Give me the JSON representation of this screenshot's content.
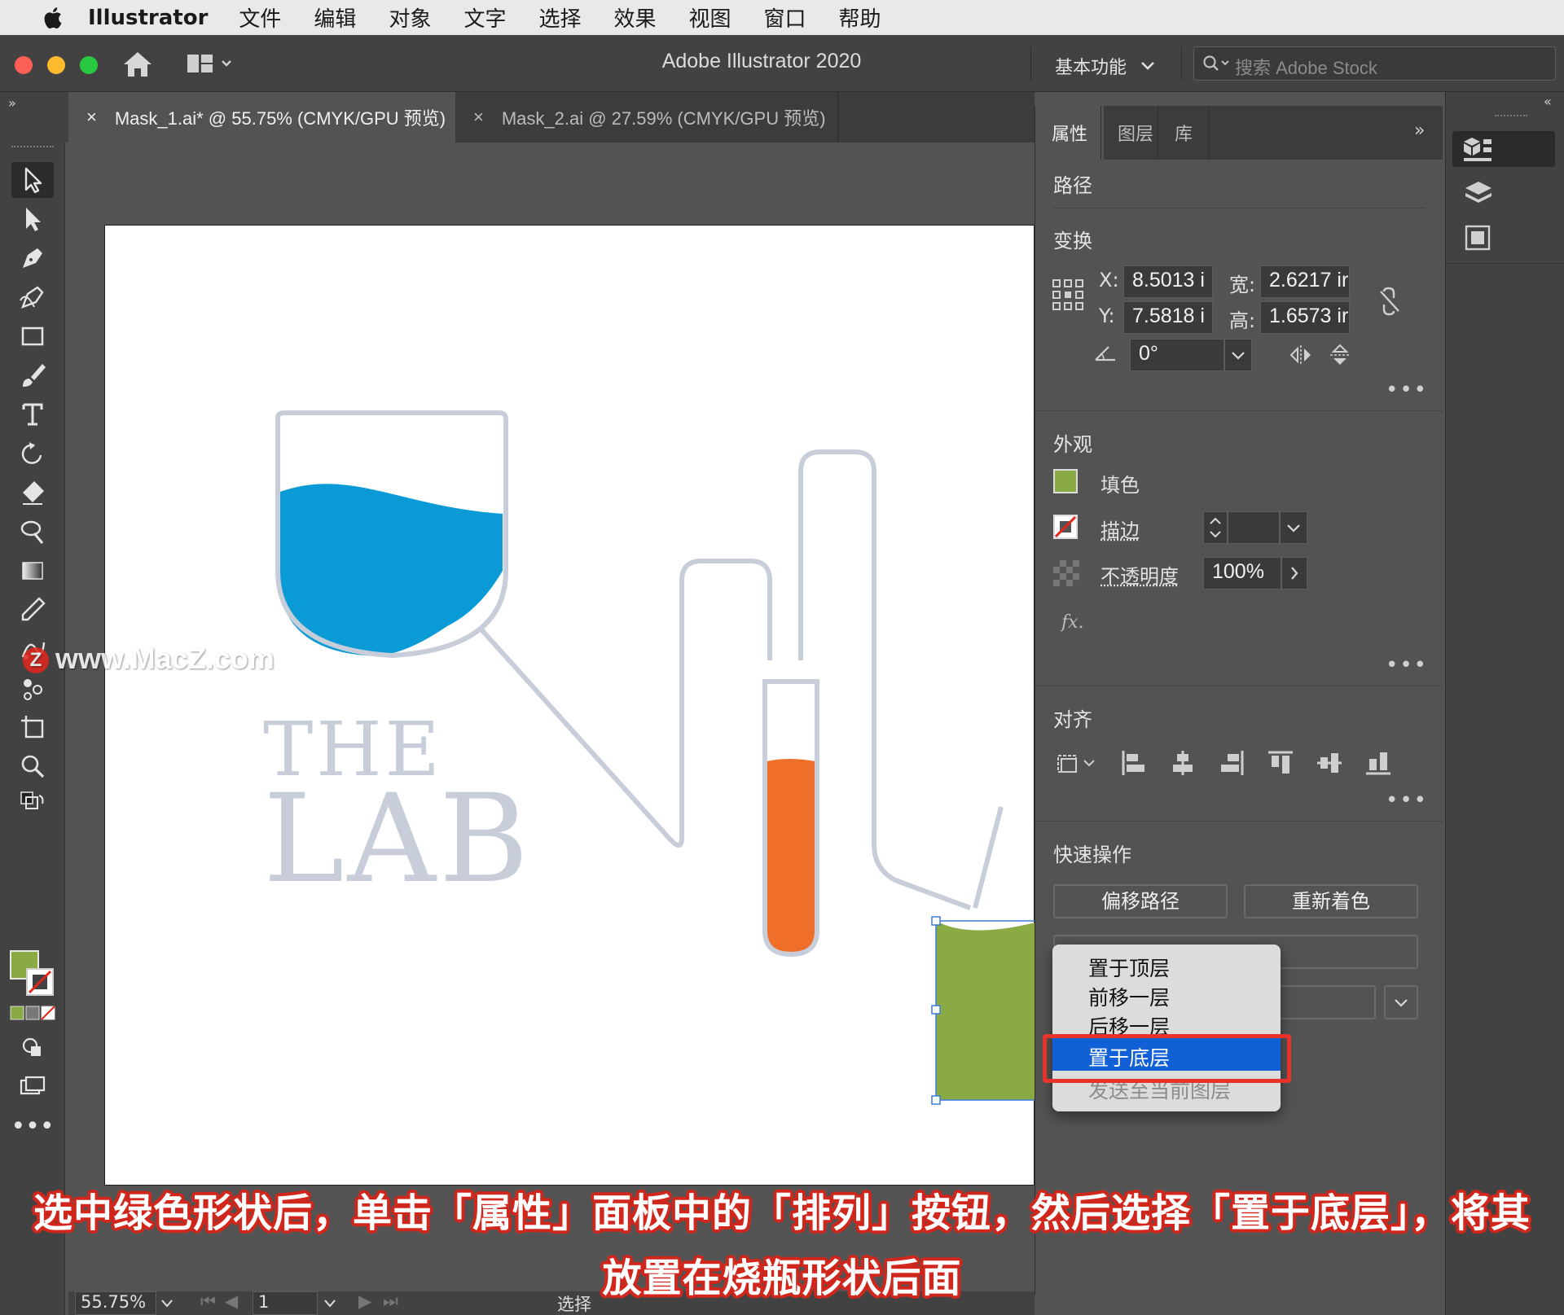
{
  "menubar": {
    "app_name": "Illustrator",
    "items": [
      "文件",
      "编辑",
      "对象",
      "文字",
      "选择",
      "效果",
      "视图",
      "窗口",
      "帮助"
    ]
  },
  "window": {
    "title": "Adobe Illustrator 2020",
    "workspace": "基本功能",
    "stock_search_placeholder": "搜索 Adobe Stock"
  },
  "tabs": [
    {
      "label": "Mask_1.ai* @ 55.75% (CMYK/GPU 预览)",
      "active": true
    },
    {
      "label": "Mask_2.ai @ 27.59% (CMYK/GPU 预览)",
      "active": false
    }
  ],
  "artwork": {
    "text_line1": "THE",
    "text_line2": "LAB",
    "colors": {
      "beaker_water": "#0a9bd6",
      "tube_liquid": "#ef6f2a",
      "green_shape": "#8aaa44",
      "line": "#c7cdd9",
      "text": "#c7cdd9"
    }
  },
  "statusbar": {
    "zoom": "55.75%",
    "artboard": "1",
    "tool": "选择"
  },
  "panel": {
    "tabs": [
      "属性",
      "图层",
      "库"
    ],
    "object_type": "路径",
    "transform": {
      "title": "变换",
      "x_label": "X:",
      "x": "8.5013 i",
      "y_label": "Y:",
      "y": "7.5818 i",
      "w_label": "宽:",
      "w": "2.6217 ir",
      "h_label": "高:",
      "h": "1.6573 ir",
      "angle": "0°"
    },
    "appearance": {
      "title": "外观",
      "fill_label": "填色",
      "stroke_label": "描边",
      "opacity_label": "不透明度",
      "opacity": "100%",
      "fx": "fx.",
      "fill_color": "#8aaa44"
    },
    "align": {
      "title": "对齐"
    },
    "quick_actions": {
      "title": "快速操作",
      "offset_path": "偏移路径",
      "recolor": "重新着色"
    }
  },
  "arrange_menu": {
    "items": [
      {
        "label": "置于顶层",
        "enabled": true
      },
      {
        "label": "前移一层",
        "enabled": true
      },
      {
        "label": "后移一层",
        "enabled": true
      },
      {
        "label": "置于底层",
        "enabled": true,
        "highlighted": true
      },
      {
        "label": "发送至当前图层",
        "enabled": false
      }
    ]
  },
  "watermark": "www.MacZ.com",
  "caption": {
    "line1": "选中绿色形状后，单击「属性」面板中的「排列」按钮，然后选择「置于底层」，将其",
    "line2": "放置在烧瓶形状后面"
  }
}
